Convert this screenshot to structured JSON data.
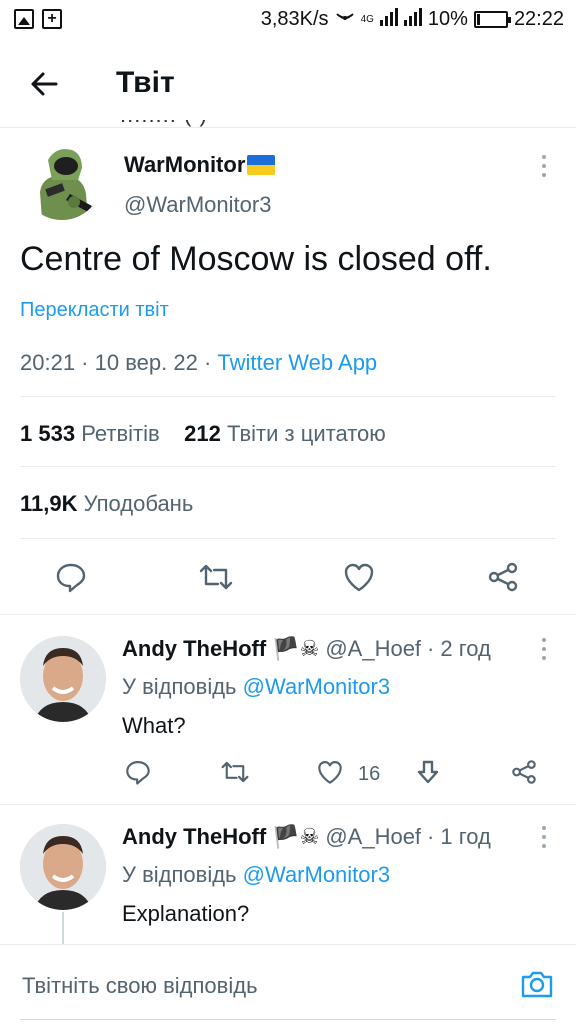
{
  "status_bar": {
    "speed": "3,83K/s",
    "network": "4G",
    "battery": "10%",
    "battery_level": 0.1,
    "time": "22:22"
  },
  "header": {
    "title": "Твіт",
    "back_icon": "arrow-left-icon",
    "partial_text": "........ ( )"
  },
  "tweet": {
    "author_name": "WarMonitor",
    "author_handle": "@WarMonitor3",
    "flag": "ukraine-flag-emoji",
    "text": "Centre of Moscow is closed off.",
    "translate_label": "Перекласти твіт",
    "time": "20:21",
    "date": "10 вер. 22",
    "source": "Twitter Web App",
    "retweets_count": "1 533",
    "retweets_label": "Ретвітів",
    "quotes_count": "212",
    "quotes_label": "Твіти з цитатою",
    "likes_count": "11,9K",
    "likes_label": "Уподобань"
  },
  "replies": [
    {
      "name": "Andy TheHoff",
      "badges": "🏴☠",
      "handle": "@A_Hoef",
      "time": "2 год",
      "reply_prefix": "У відповідь",
      "reply_to": "@WarMonitor3",
      "text": "What?",
      "like_count": "16"
    },
    {
      "name": "Andy TheHoff",
      "badges": "🏴☠",
      "handle": "@A_Hoef",
      "time": "1 год",
      "reply_prefix": "У відповідь",
      "reply_to": "@WarMonitor3",
      "text": "Explanation?"
    }
  ],
  "compose": {
    "placeholder": "Твітніть свою відповідь",
    "camera_icon": "camera-icon"
  },
  "colors": {
    "accent": "#1d9bf0",
    "secondary_text": "#536471",
    "divider": "#e6ecf0"
  }
}
